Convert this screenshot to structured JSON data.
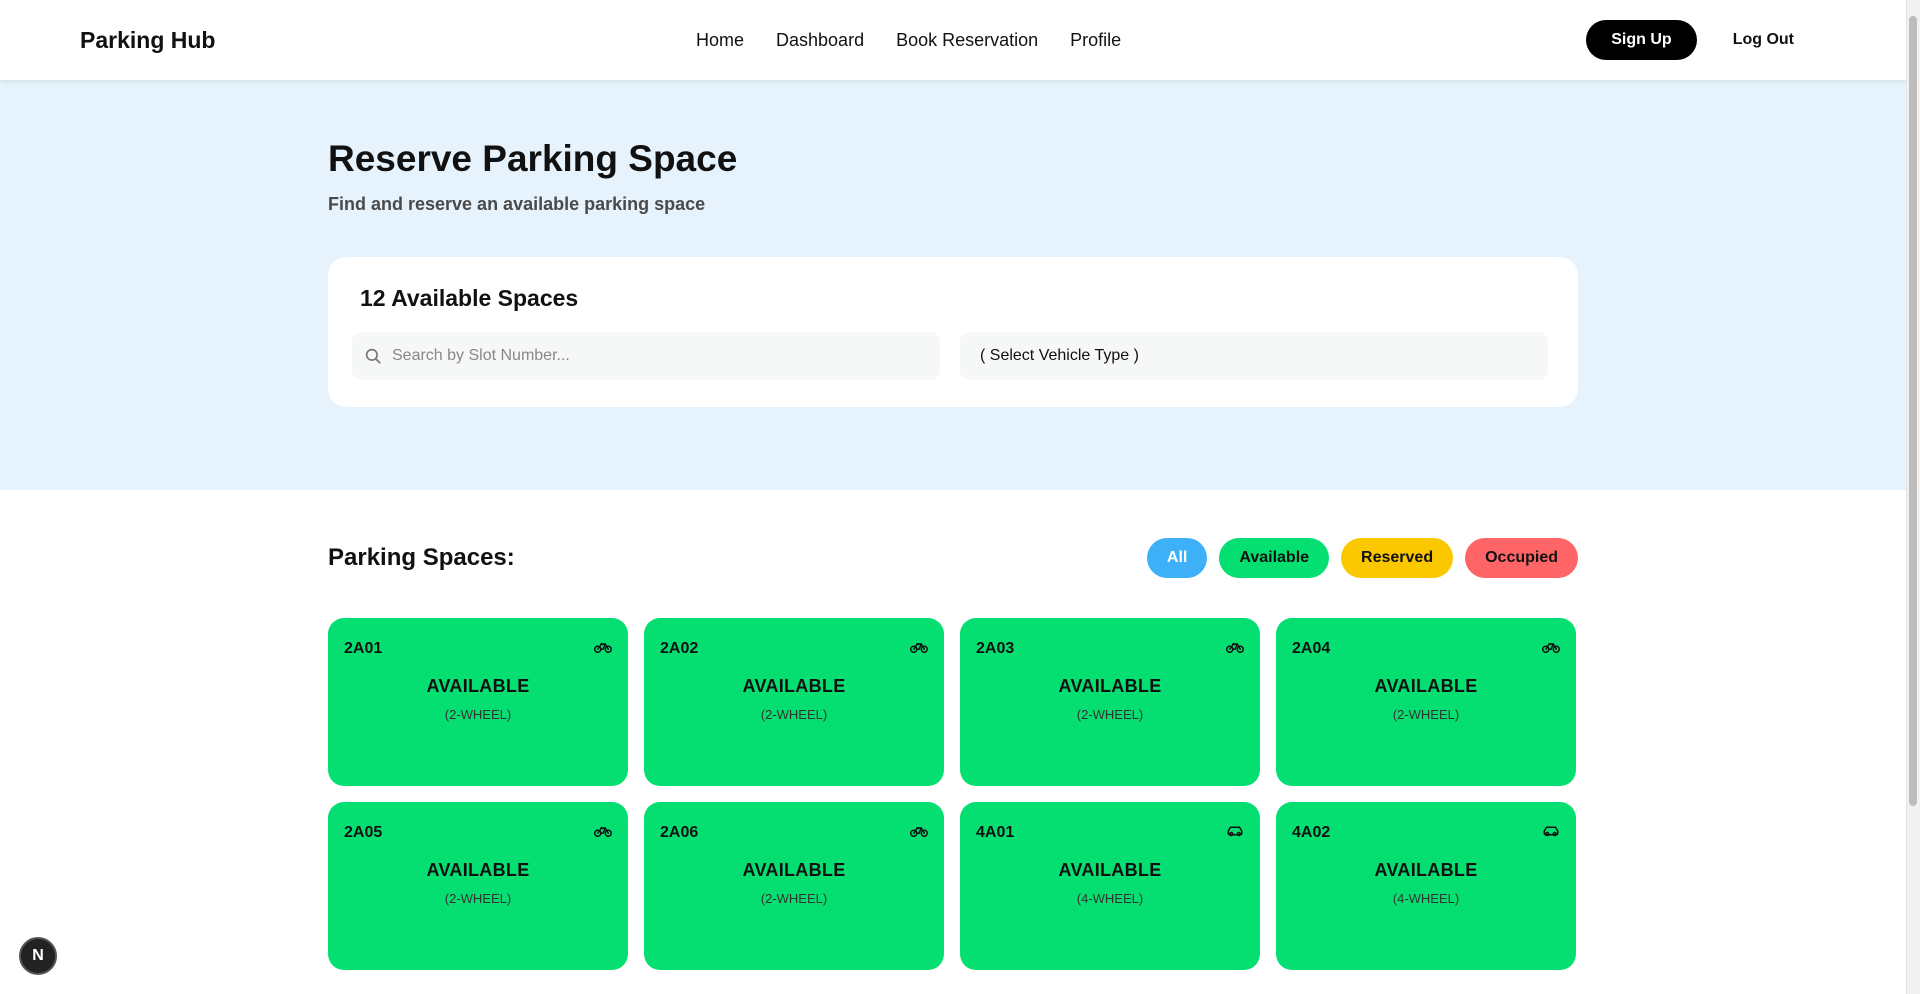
{
  "nav": {
    "brand": "Parking Hub",
    "links": [
      "Home",
      "Dashboard",
      "Book Reservation",
      "Profile"
    ],
    "signup": "Sign Up",
    "logout": "Log Out"
  },
  "hero": {
    "title": "Reserve Parking Space",
    "subtitle": "Find and reserve an available parking space",
    "available_count": "12 Available Spaces",
    "search_placeholder": "Search by Slot Number...",
    "vehicle_select": "( Select Vehicle Type )"
  },
  "spaces": {
    "heading": "Parking Spaces:",
    "filters": [
      {
        "label": "All",
        "color": "#3eb0f7",
        "text_color": "#ffffff"
      },
      {
        "label": "Available",
        "color": "#05df72",
        "text_color": "#111111"
      },
      {
        "label": "Reserved",
        "color": "#fbc800",
        "text_color": "#111111"
      },
      {
        "label": "Occupied",
        "color": "#ff6467",
        "text_color": "#111111"
      }
    ],
    "slots": [
      {
        "id": "2A01",
        "status": "AVAILABLE",
        "type": "(2-WHEEL)",
        "icon": "bike-icon"
      },
      {
        "id": "2A02",
        "status": "AVAILABLE",
        "type": "(2-WHEEL)",
        "icon": "bike-icon"
      },
      {
        "id": "2A03",
        "status": "AVAILABLE",
        "type": "(2-WHEEL)",
        "icon": "bike-icon"
      },
      {
        "id": "2A04",
        "status": "AVAILABLE",
        "type": "(2-WHEEL)",
        "icon": "bike-icon"
      },
      {
        "id": "2A05",
        "status": "AVAILABLE",
        "type": "(2-WHEEL)",
        "icon": "bike-icon"
      },
      {
        "id": "2A06",
        "status": "AVAILABLE",
        "type": "(2-WHEEL)",
        "icon": "bike-icon"
      },
      {
        "id": "4A01",
        "status": "AVAILABLE",
        "type": "(4-WHEEL)",
        "icon": "car-icon"
      },
      {
        "id": "4A02",
        "status": "AVAILABLE",
        "type": "(4-WHEEL)",
        "icon": "car-icon"
      }
    ]
  },
  "badge": "N"
}
